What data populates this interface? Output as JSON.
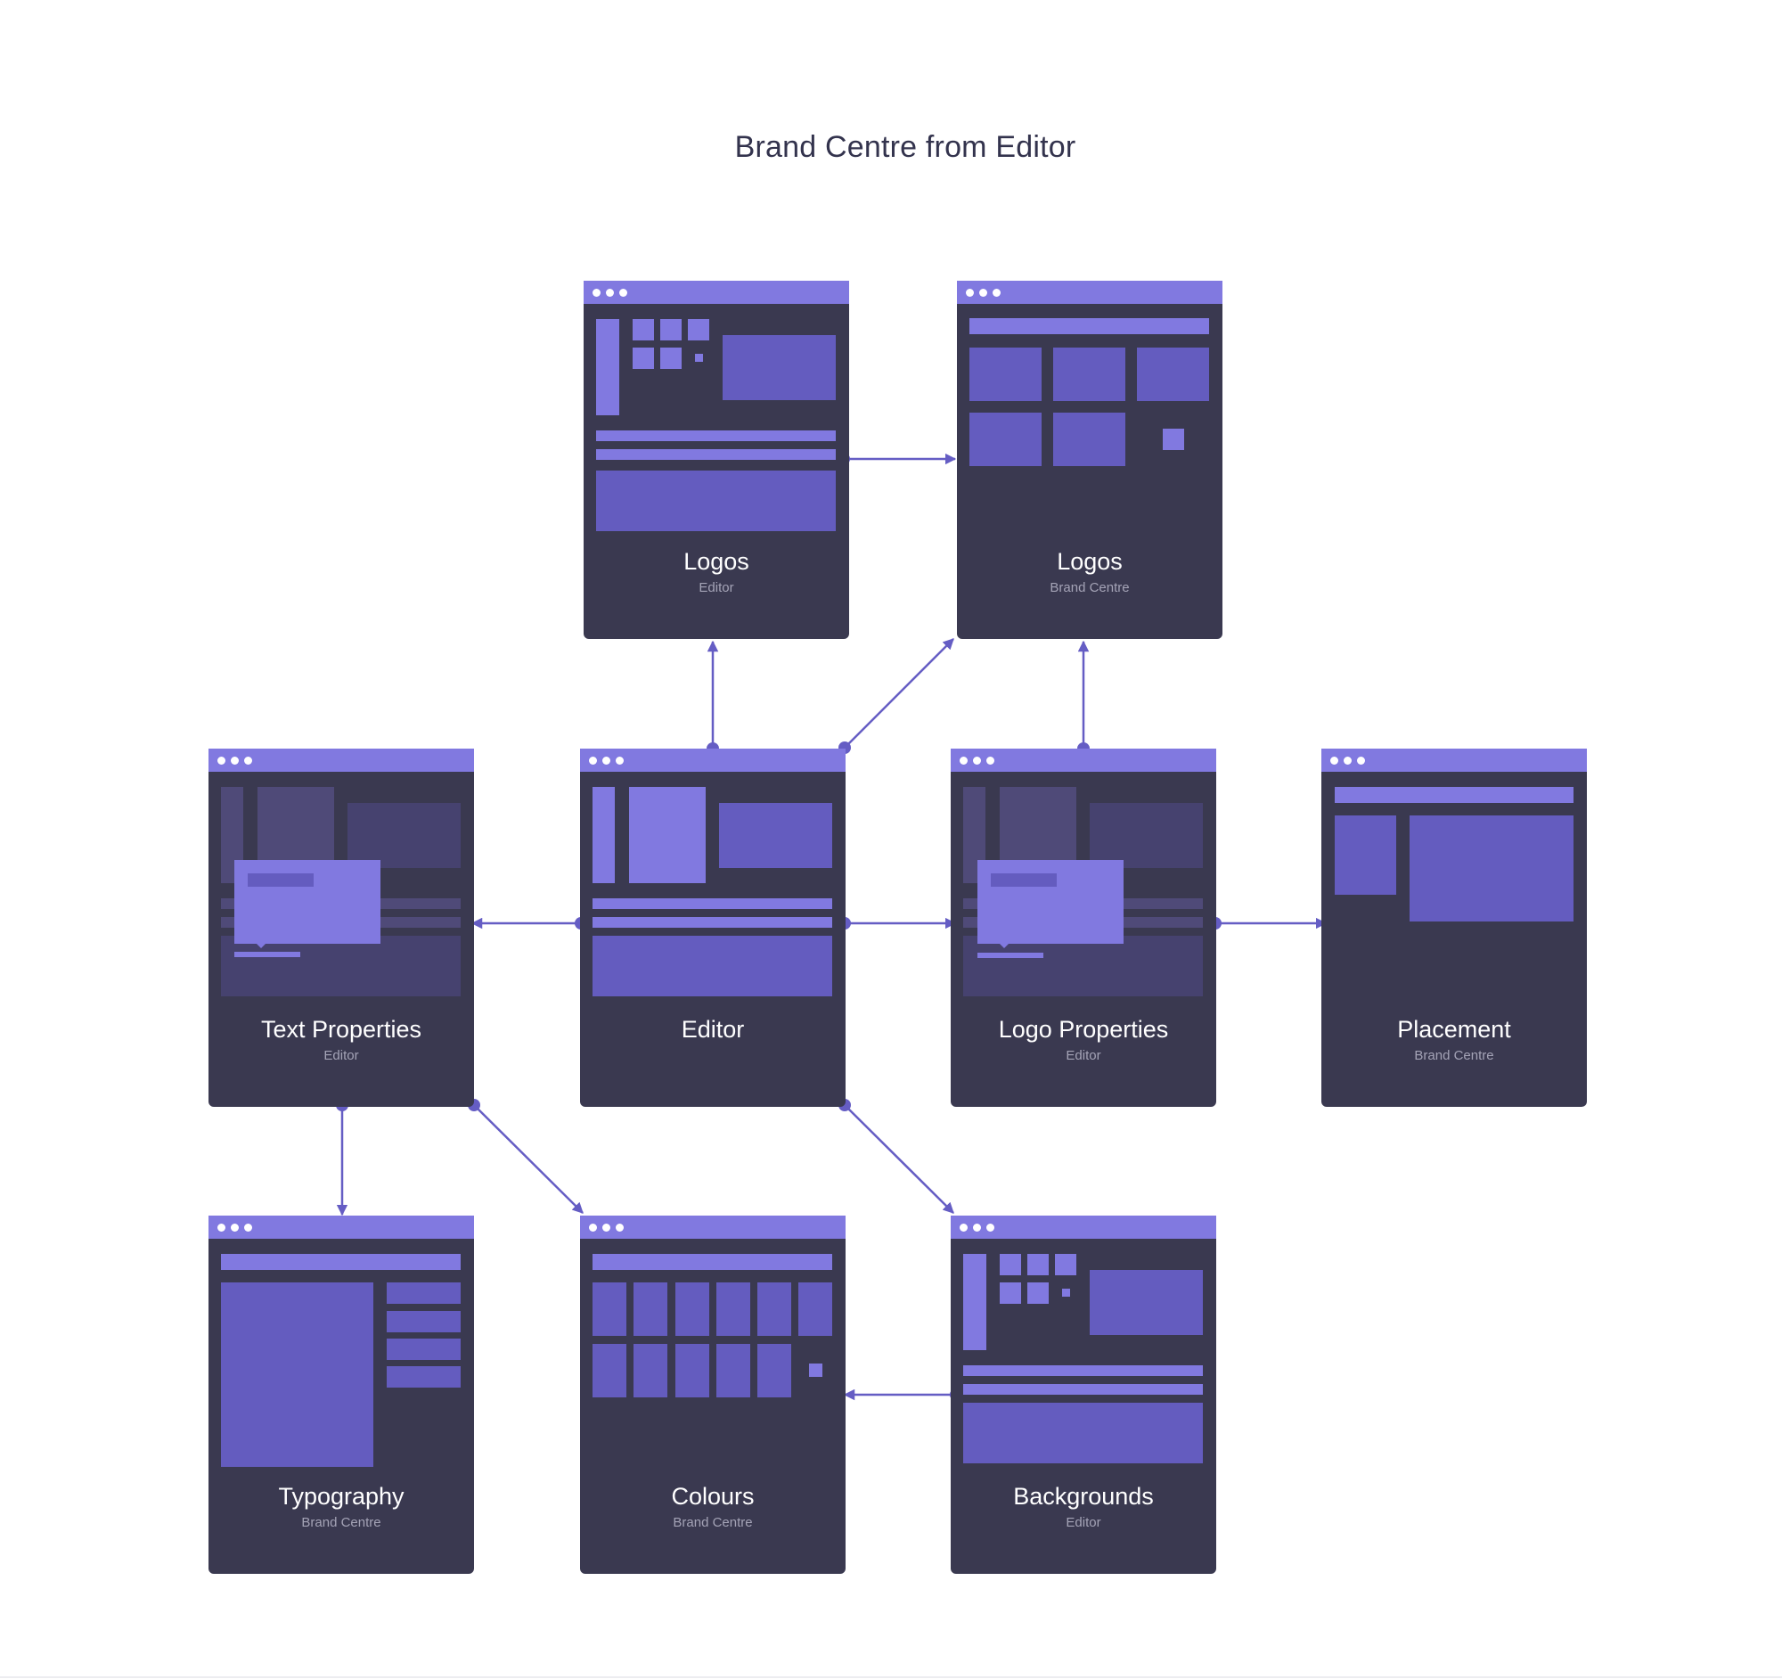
{
  "title": "Brand Centre from Editor",
  "colors": {
    "card_bg": "#3a3950",
    "header": "#8179e0",
    "accent_light": "#8179e0",
    "accent_mid": "#645cbf",
    "connector": "#655dc4",
    "title_text": "#33334d",
    "subtitle_text": "#a4a3b6"
  },
  "cards": {
    "logos_editor": {
      "name": "Logos",
      "context": "Editor"
    },
    "logos_brand": {
      "name": "Logos",
      "context": "Brand Centre"
    },
    "text_properties": {
      "name": "Text Properties",
      "context": "Editor"
    },
    "editor": {
      "name": "Editor",
      "context": ""
    },
    "logo_properties": {
      "name": "Logo Properties",
      "context": "Editor"
    },
    "placement": {
      "name": "Placement",
      "context": "Brand Centre"
    },
    "typography": {
      "name": "Typography",
      "context": "Brand Centre"
    },
    "colours": {
      "name": "Colours",
      "context": "Brand Centre"
    },
    "backgrounds": {
      "name": "Backgrounds",
      "context": "Editor"
    }
  },
  "connections": [
    {
      "from": "editor",
      "to": "logos_editor"
    },
    {
      "from": "editor",
      "to": "logos_brand"
    },
    {
      "from": "logos_editor",
      "to": "logos_brand"
    },
    {
      "from": "logo_properties",
      "to": "logos_brand"
    },
    {
      "from": "editor",
      "to": "text_properties"
    },
    {
      "from": "editor",
      "to": "logo_properties"
    },
    {
      "from": "logo_properties",
      "to": "placement"
    },
    {
      "from": "text_properties",
      "to": "typography"
    },
    {
      "from": "text_properties",
      "to": "colours"
    },
    {
      "from": "editor",
      "to": "backgrounds"
    },
    {
      "from": "backgrounds",
      "to": "colours"
    }
  ]
}
